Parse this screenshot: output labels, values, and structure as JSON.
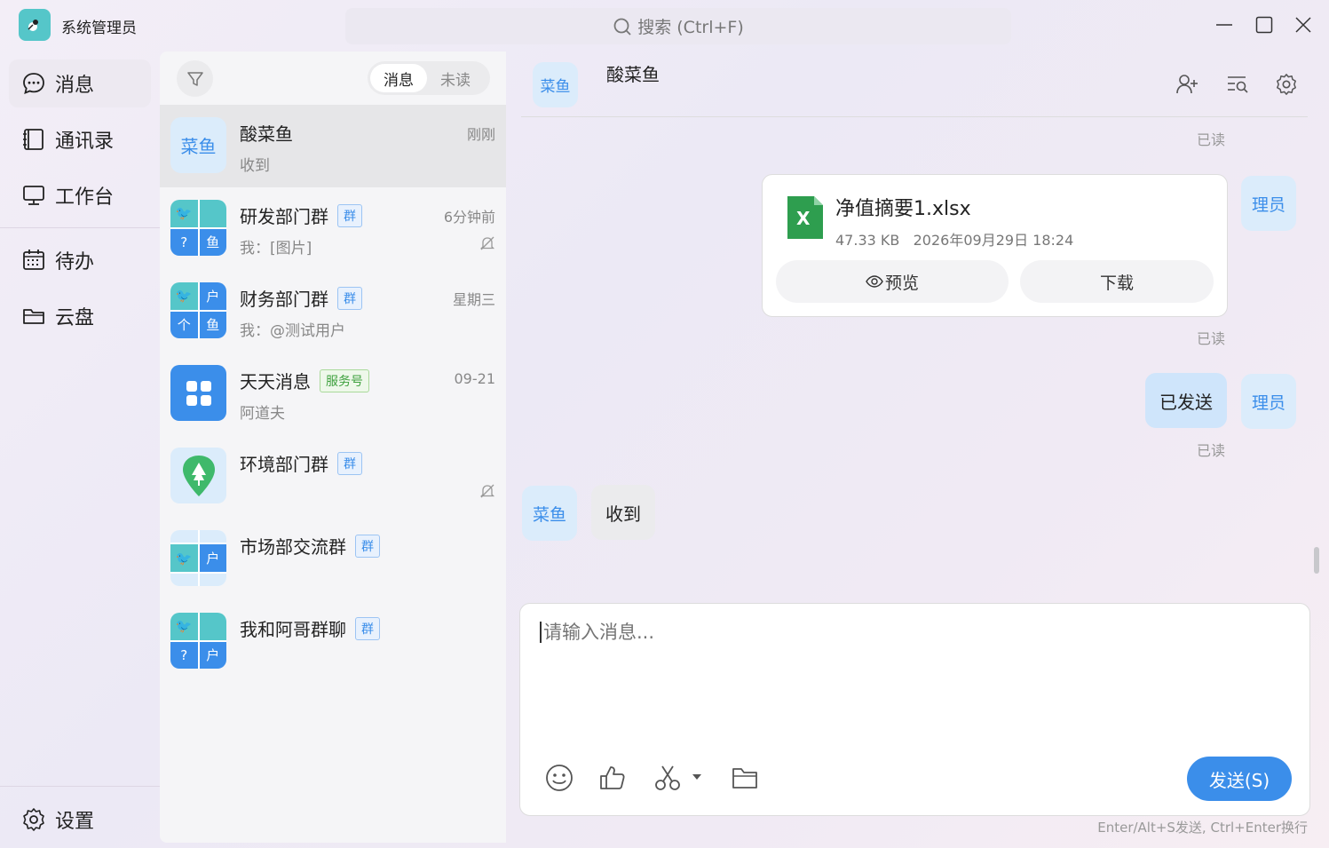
{
  "app": {
    "name": "系统管理员"
  },
  "search": {
    "placeholder": "搜索 (Ctrl+F)"
  },
  "nav": {
    "items": [
      {
        "label": "消息",
        "icon": "message-icon"
      },
      {
        "label": "通讯录",
        "icon": "contacts-icon"
      },
      {
        "label": "工作台",
        "icon": "workbench-icon"
      },
      {
        "label": "待办",
        "icon": "calendar-icon"
      },
      {
        "label": "云盘",
        "icon": "folder-icon"
      }
    ],
    "settings": "设置"
  },
  "conv_list": {
    "tabs": [
      "消息",
      "未读"
    ],
    "items": [
      {
        "name": "酸菜鱼",
        "avatar_text": "菜鱼",
        "preview": "收到",
        "time": "刚刚",
        "badge": ""
      },
      {
        "name": "研发部门群",
        "badge": "群",
        "preview": "我：[图片]",
        "time": "6分钟前",
        "quad": [
          "",
          "",
          "?",
          "鱼"
        ]
      },
      {
        "name": "财务部门群",
        "badge": "群",
        "preview": "我：@测试用户",
        "time": "星期三",
        "quad": [
          "",
          "户",
          "个",
          "鱼"
        ]
      },
      {
        "name": "天天消息",
        "badge": "服务号",
        "preview": "阿道夫",
        "time": "09-21"
      },
      {
        "name": "环境部门群",
        "badge": "群",
        "preview": "",
        "time": ""
      },
      {
        "name": "市场部交流群",
        "badge": "群",
        "preview": "",
        "time": "",
        "quad": [
          "",
          "户"
        ]
      },
      {
        "name": "我和阿哥群聊",
        "badge": "群",
        "preview": "",
        "time": "",
        "quad": [
          "",
          "",
          "?",
          "户"
        ]
      }
    ]
  },
  "chat": {
    "title": "酸菜鱼",
    "avatar_text": "菜鱼",
    "messages": {
      "read_1": "已读",
      "file": {
        "name": "净值摘要1.xlsx",
        "size": "47.33 KB",
        "date": "2026年09月29日 18:24",
        "preview_btn": "预览",
        "download_btn": "下载"
      },
      "read_2": "已读",
      "sent_text": "已发送",
      "read_3": "已读",
      "received_text": "收到",
      "my_avatar_text": "理员",
      "their_avatar_text": "菜鱼"
    },
    "composer": {
      "placeholder": "请输入消息...",
      "send_label": "发送(S)",
      "hint": "Enter/Alt+S发送, Ctrl+Enter换行"
    }
  },
  "colors": {
    "accent": "#3b8eea",
    "teal": "#55c6c9",
    "excel_green": "#2e9e4f"
  }
}
